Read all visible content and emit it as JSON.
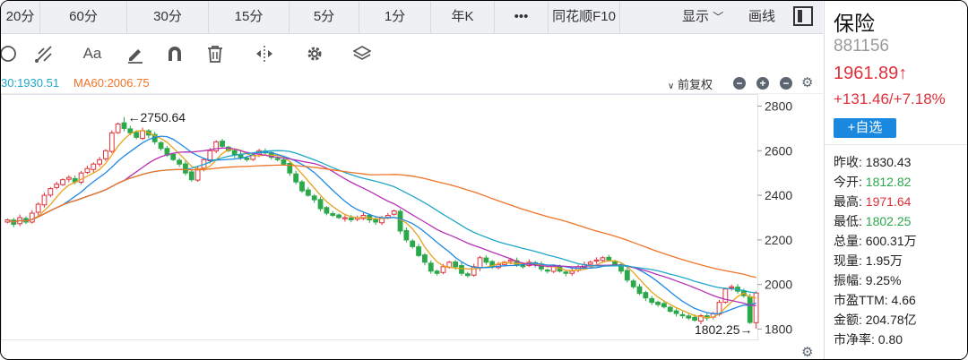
{
  "tabs": [
    "20分",
    "60分",
    "30分",
    "15分",
    "5分",
    "1分",
    "年K",
    "•••",
    "同花顺F10"
  ],
  "tabbar_right": {
    "display_label": "显示",
    "drawline_label": "画线"
  },
  "toolbar": {
    "text_tool_label": "Aa"
  },
  "indicators": {
    "ma30": "30:1930.51",
    "ma60": "MA60:2006.75",
    "adjust_label": "前复权"
  },
  "colors": {
    "up": "#e0303a",
    "down": "#2aa84a",
    "ma5": "#e8a21c",
    "ma10": "#1e88e5",
    "ma20": "#b533b5",
    "ma30": "#1fa7c9",
    "ma60": "#f07428"
  },
  "quote": {
    "name": "保险",
    "code": "881156",
    "price": "1961.89↑",
    "change": "+131.46/+7.18%",
    "add_watchlist": "+自选",
    "stats": [
      {
        "label": "昨收:",
        "value": "1830.43",
        "tone": "neutral"
      },
      {
        "label": "今开:",
        "value": "1812.82",
        "tone": "down"
      },
      {
        "label": "最高:",
        "value": "1971.64",
        "tone": "up"
      },
      {
        "label": "最低:",
        "value": "1802.25",
        "tone": "down"
      },
      {
        "label": "总量:",
        "value": "600.31万",
        "tone": "neutral"
      },
      {
        "label": "现量:",
        "value": "1.95万",
        "tone": "neutral"
      },
      {
        "label": "振幅:",
        "value": "9.25%",
        "tone": "neutral"
      },
      {
        "label": "市盈TTM:",
        "value": "4.66",
        "tone": "neutral"
      },
      {
        "label": "金额:",
        "value": "204.78亿",
        "tone": "neutral"
      },
      {
        "label": "市净率:",
        "value": "0.80",
        "tone": "neutral"
      }
    ]
  },
  "chart_data": {
    "type": "candlestick",
    "yaxis_ticks": [
      2800,
      2600,
      2400,
      2200,
      2000,
      1800
    ],
    "ylim": [
      1770,
      2830
    ],
    "annotations": {
      "high_label": "←2750.64",
      "high_value": 2750.64,
      "low_label": "1802.25→",
      "low_value": 1802.25
    },
    "close_series": [
      2290,
      2270,
      2300,
      2280,
      2320,
      2360,
      2400,
      2430,
      2450,
      2470,
      2480,
      2460,
      2500,
      2520,
      2540,
      2560,
      2600,
      2680,
      2720,
      2700,
      2680,
      2660,
      2690,
      2670,
      2640,
      2610,
      2580,
      2560,
      2540,
      2500,
      2470,
      2520,
      2560,
      2600,
      2640,
      2620,
      2600,
      2580,
      2570,
      2560,
      2580,
      2600,
      2590,
      2570,
      2560,
      2540,
      2500,
      2460,
      2420,
      2400,
      2380,
      2340,
      2320,
      2310,
      2300,
      2300,
      2290,
      2300,
      2310,
      2290,
      2280,
      2300,
      2310,
      2330,
      2240,
      2200,
      2170,
      2130,
      2100,
      2060,
      2050,
      2080,
      2100,
      2080,
      2050,
      2040,
      2080,
      2120,
      2100,
      2080,
      2090,
      2100,
      2110,
      2090,
      2080,
      2100,
      2090,
      2070,
      2060,
      2080,
      2060,
      2050,
      2060,
      2080,
      2090,
      2100,
      2110,
      2120,
      2110,
      2090,
      2060,
      2020,
      1990,
      1960,
      1940,
      1920,
      1910,
      1900,
      1880,
      1870,
      1860,
      1850,
      1840,
      1860,
      1850,
      1870,
      1920,
      1980,
      1990,
      1970,
      1950,
      1830,
      1962
    ]
  }
}
